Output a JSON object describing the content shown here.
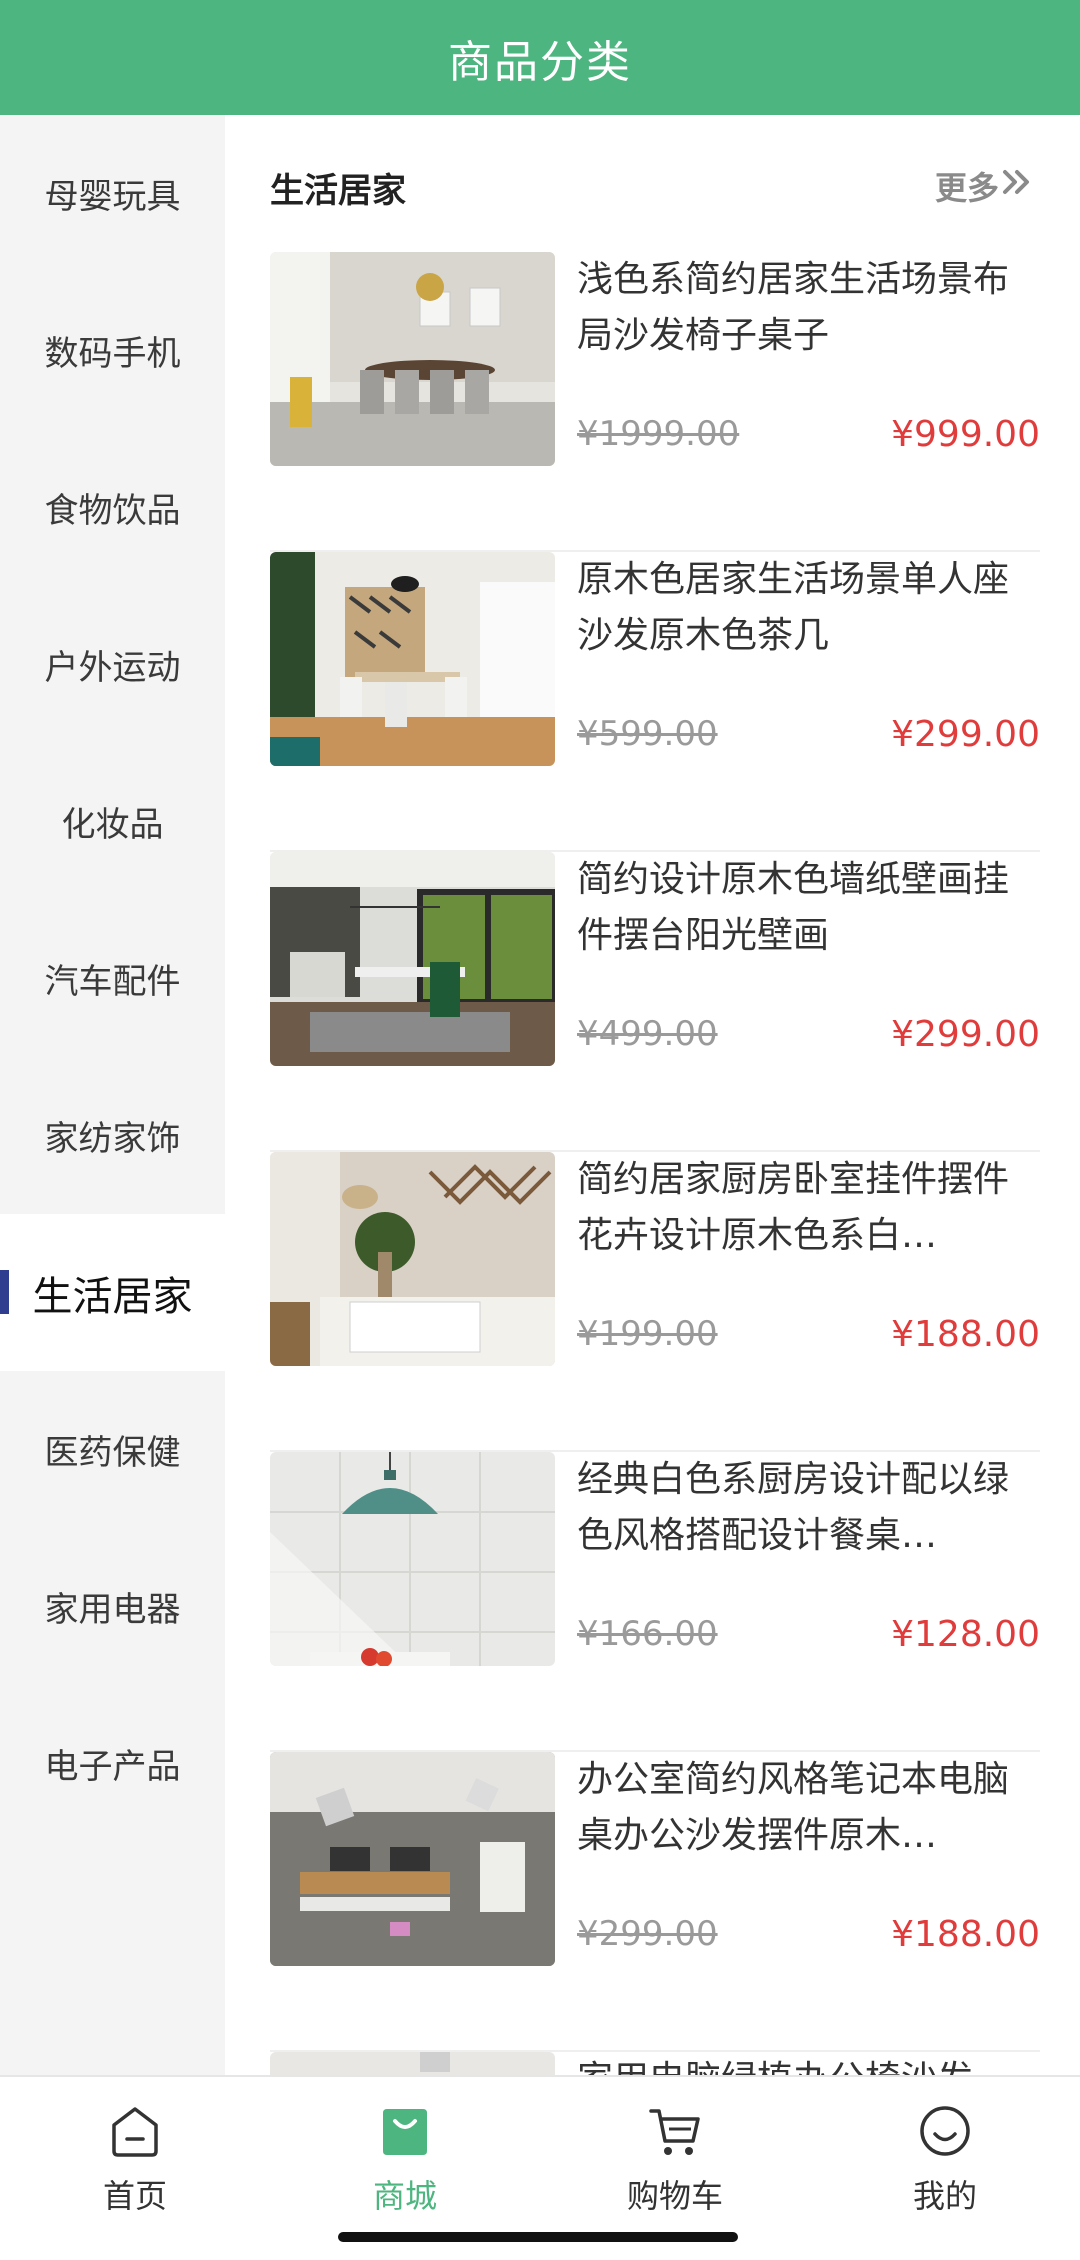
{
  "header": {
    "title": "商品分类"
  },
  "sidebar": {
    "active_index": 7,
    "items": [
      {
        "label": "母婴玩具"
      },
      {
        "label": "数码手机"
      },
      {
        "label": "食物饮品"
      },
      {
        "label": "户外运动"
      },
      {
        "label": "化妆品"
      },
      {
        "label": "汽车配件"
      },
      {
        "label": "家纺家饰"
      },
      {
        "label": "生活居家"
      },
      {
        "label": "医药保健"
      },
      {
        "label": "家用电器"
      },
      {
        "label": "电子产品"
      }
    ]
  },
  "section": {
    "title": "生活居家",
    "more_label": "更多",
    "more_icon": "double-chevron-right-icon"
  },
  "products": [
    {
      "name": "浅色系简约居家生活场景布局沙发椅子桌子",
      "old_price": "¥1999.00",
      "price": "¥999.00",
      "image": "dining-room-photo"
    },
    {
      "name": "原木色居家生活场景单人座沙发原木色茶几",
      "old_price": "¥599.00",
      "price": "¥299.00",
      "image": "wood-dining-photo"
    },
    {
      "name": "简约设计原木色墙纸壁画挂件摆台阳光壁画",
      "old_price": "¥499.00",
      "price": "¥299.00",
      "image": "sunroom-dining-photo"
    },
    {
      "name": "简约居家厨房卧室挂件摆件花卉设计原木色系白…",
      "old_price": "¥199.00",
      "price": "¥188.00",
      "image": "desk-plant-photo"
    },
    {
      "name": "经典白色系厨房设计配以绿色风格搭配设计餐桌…",
      "old_price": "¥166.00",
      "price": "¥128.00",
      "image": "green-lamp-photo"
    },
    {
      "name": "办公室简约风格笔记本电脑桌办公沙发摆件原木…",
      "old_price": "¥299.00",
      "price": "¥188.00",
      "image": "office-desks-photo"
    },
    {
      "name": "家用电脑绿植办公椅沙发",
      "old_price": "",
      "price": "",
      "image": "partial-photo"
    }
  ],
  "tabbar": {
    "active_index": 1,
    "items": [
      {
        "label": "首页",
        "icon": "home-icon"
      },
      {
        "label": "商城",
        "icon": "shopping-bag-icon"
      },
      {
        "label": "购物车",
        "icon": "cart-icon"
      },
      {
        "label": "我的",
        "icon": "smiley-profile-icon"
      }
    ]
  },
  "colors": {
    "brand": "#4db57f",
    "price": "#e03c3c",
    "active_indicator": "#2f3e8e"
  }
}
